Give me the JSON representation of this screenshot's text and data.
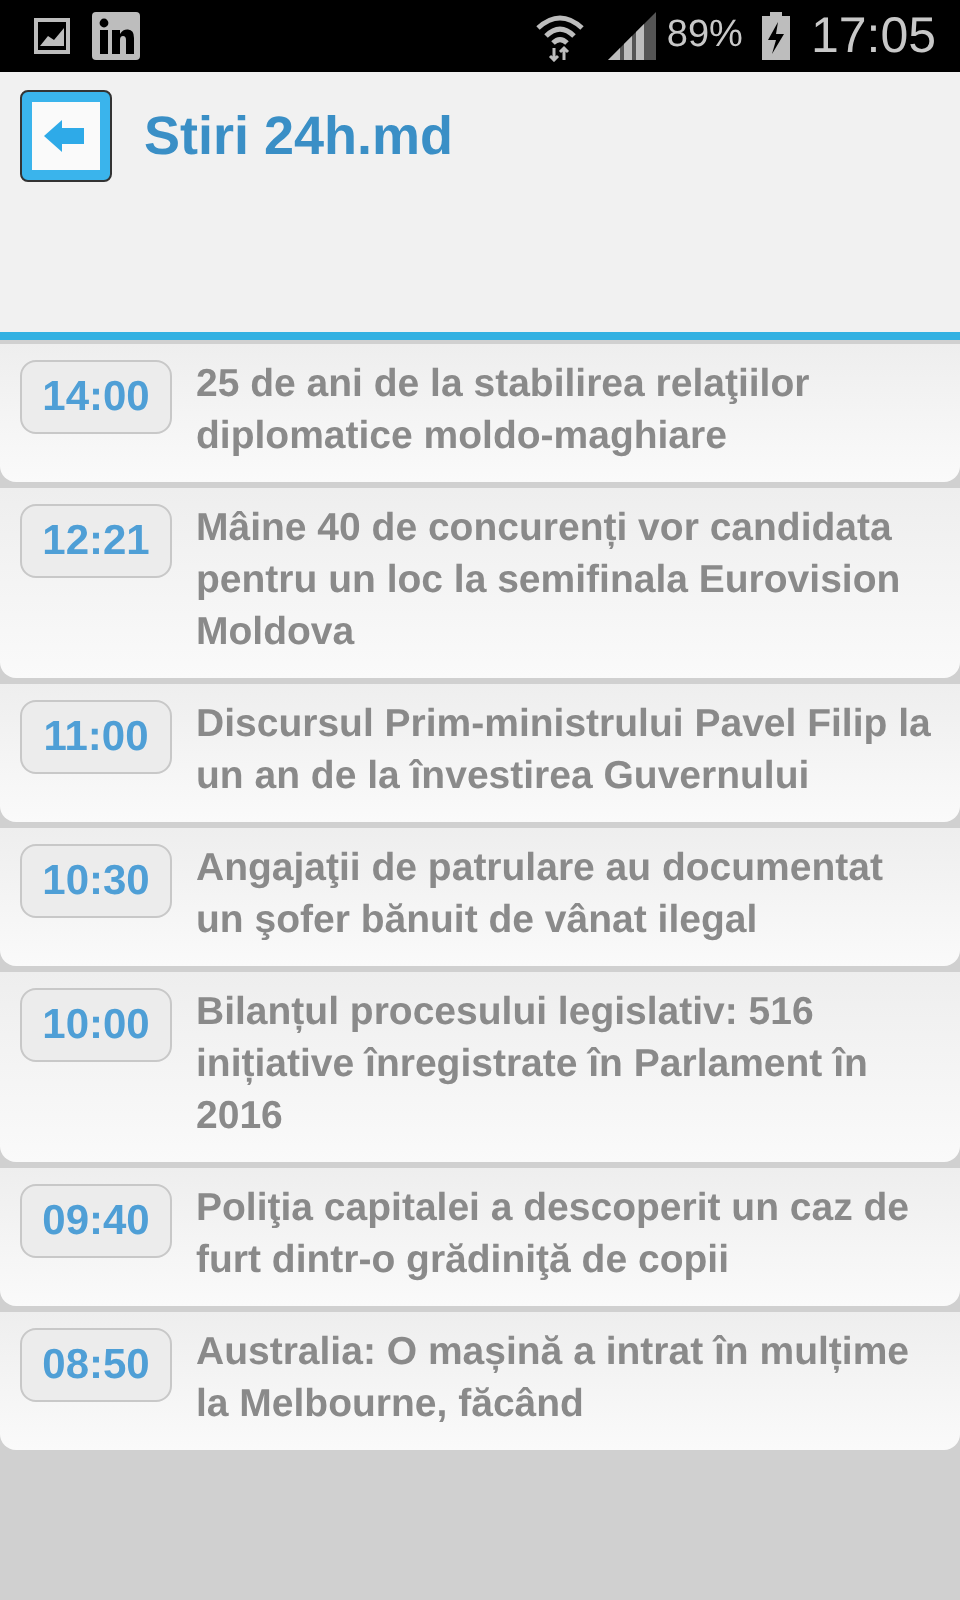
{
  "status_bar": {
    "battery": "89%",
    "time": "17:05"
  },
  "header": {
    "title": "Stiri 24h.md"
  },
  "news": [
    {
      "time": "14:00",
      "headline": "25 de ani de la stabilirea relaţiilor diplomatice moldo-maghiare"
    },
    {
      "time": "12:21",
      "headline": "Mâine 40 de concurenți vor candidata pentru un loc la semifinala Eurovision Moldova"
    },
    {
      "time": "11:00",
      "headline": "Discursul Prim-ministrului Pavel Filip la un an de la învestirea Guvernului"
    },
    {
      "time": "10:30",
      "headline": "Angajaţii de patrulare au documentat un şofer bănuit de vânat ilegal"
    },
    {
      "time": "10:00",
      "headline": "Bilanțul procesului legislativ: 516 inițiative înregistrate în Parlament în 2016"
    },
    {
      "time": "09:40",
      "headline": "Poliţia capitalei a descoperit un caz de furt dintr-o grădiniţă de copii"
    },
    {
      "time": "08:50",
      "headline": "Australia: O mașină a intrat în mulțime la Melbourne, făcând"
    }
  ]
}
